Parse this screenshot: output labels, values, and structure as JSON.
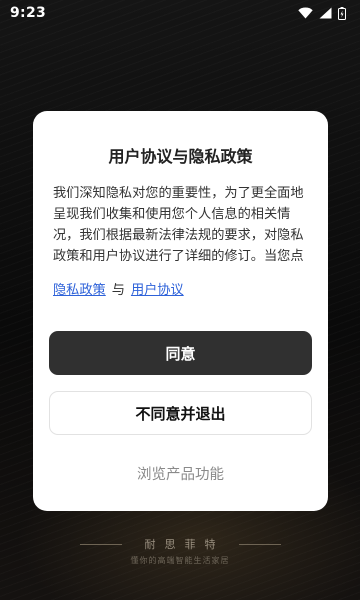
{
  "status_bar": {
    "time": "9:23"
  },
  "dialog": {
    "title": "用户协议与隐私政策",
    "body_text": "我们深知隐私对您的重要性，为了更全面地呈现我们收集和使用您个人信息的相关情况，我们根据最新法律法规的要求，对隐私政策和用户协议进行了详细的修订。当您点击「同意」即表示您已充分阅读",
    "privacy_link": "隐私政策",
    "and_text": "与",
    "user_agreement_link": "用户协议",
    "agree_button": "同意",
    "disagree_button": "不同意并退出",
    "browse_link": "浏览产品功能"
  },
  "background": {
    "brand_name": "耐思菲特",
    "slogan": "懂你的高端智能生活家居"
  },
  "colors": {
    "link": "#2e62d9",
    "primary_button": "#303030"
  }
}
